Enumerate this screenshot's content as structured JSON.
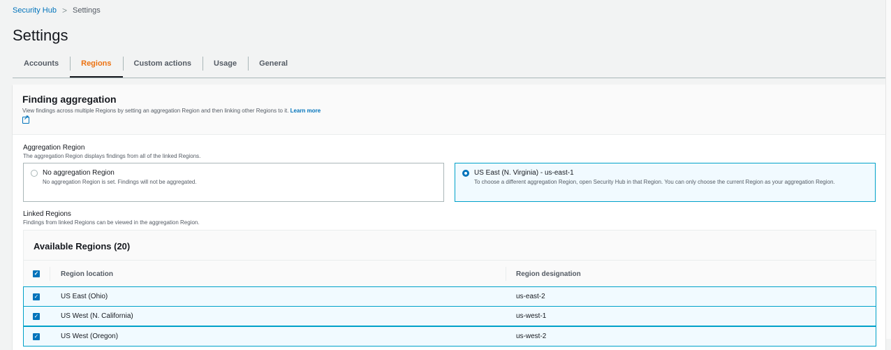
{
  "breadcrumb": {
    "parent": "Security Hub",
    "current": "Settings"
  },
  "page_title": "Settings",
  "tabs": [
    {
      "label": "Accounts"
    },
    {
      "label": "Regions",
      "active": true
    },
    {
      "label": "Custom actions"
    },
    {
      "label": "Usage"
    },
    {
      "label": "General"
    }
  ],
  "panel": {
    "title": "Finding aggregation",
    "description": "View findings across multiple Regions by setting an aggregation Region and then linking other Regions to it.",
    "learn_more": "Learn more"
  },
  "aggregation": {
    "label": "Aggregation Region",
    "description": "The aggregation Region displays findings from all of the linked Regions.",
    "options": [
      {
        "title": "No aggregation Region",
        "description": "No aggregation Region is set. Findings will not be aggregated.",
        "selected": false
      },
      {
        "title": "US East (N. Virginia) - us-east-1",
        "description": "To choose a different aggregation Region, open Security Hub in that Region. You can only choose the current Region as your aggregation Region.",
        "selected": true
      }
    ]
  },
  "linked": {
    "label": "Linked Regions",
    "description": "Findings from linked Regions can be viewed in the aggregation Region."
  },
  "table": {
    "title": "Available Regions (20)",
    "columns": [
      "Region location",
      "Region designation"
    ],
    "rows": [
      {
        "location": "US East (Ohio)",
        "designation": "us-east-2"
      },
      {
        "location": "US West (N. California)",
        "designation": "us-west-1"
      },
      {
        "location": "US West (Oregon)",
        "designation": "us-west-2"
      }
    ]
  },
  "colors": {
    "accent": "#ec7211",
    "link": "#0073bb",
    "selected_border": "#00a1c9"
  }
}
